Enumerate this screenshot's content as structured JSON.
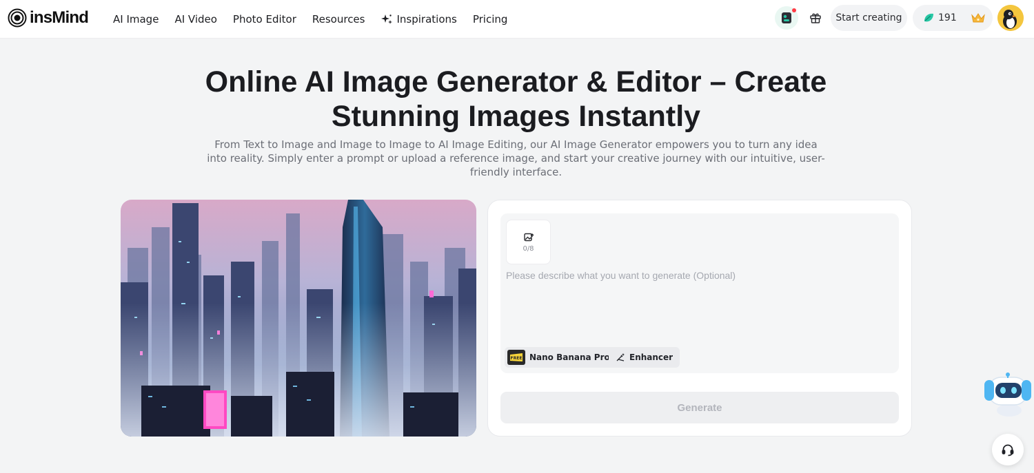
{
  "brand": {
    "name": "insMind"
  },
  "nav": {
    "items": [
      {
        "label": "AI Image"
      },
      {
        "label": "AI Video"
      },
      {
        "label": "Photo Editor"
      },
      {
        "label": "Resources"
      },
      {
        "label": "Inspirations",
        "icon": "sparkle-icon"
      },
      {
        "label": "Pricing"
      }
    ]
  },
  "header_right": {
    "start_label": "Start creating",
    "credits": "191",
    "icons": [
      "app-icon",
      "gift-icon",
      "leaf-credit-icon",
      "crown-icon",
      "avatar"
    ]
  },
  "hero": {
    "title_line1": "Online AI Image Generator & Editor – Create",
    "title_line2": "Stunning Images Instantly",
    "subtitle": "From Text to Image and Image to Image to AI Image Editing, our AI Image Generator empowers you to turn any idea into reality. Simply enter a prompt or upload a reference image, and start your creative journey with our intuitive, user-friendly interface."
  },
  "generator": {
    "upload_count": "0/8",
    "prompt_placeholder": "Please describe what you want to generate (Optional)",
    "model_label": "Nano Banana Pro",
    "enhancer_label": "Enhancer",
    "generate_label": "Generate"
  },
  "colors": {
    "page_bg": "#f3f4f5",
    "accent_green": "#27c7a5",
    "crown": "#f6b73c"
  }
}
